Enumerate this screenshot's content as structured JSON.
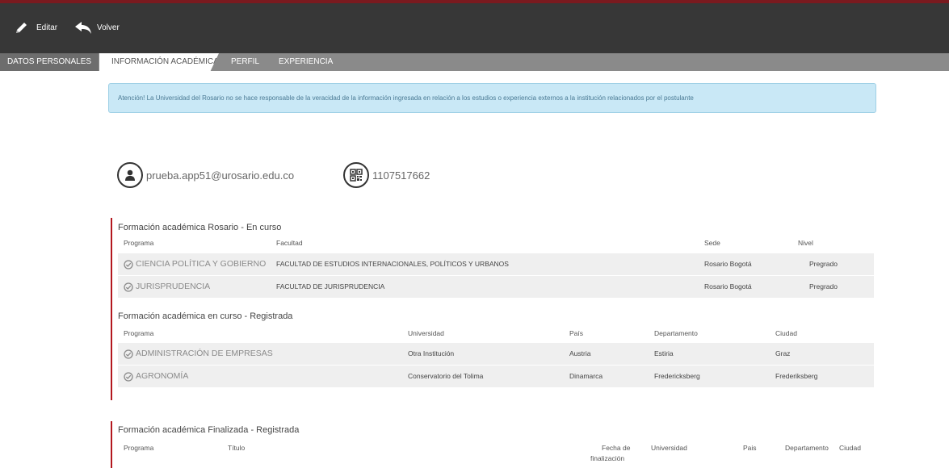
{
  "toolbar": {
    "edit_label": "Editar",
    "back_label": "Volver",
    "edit_icon": "pencil-icon",
    "back_icon": "undo-arrow-icon"
  },
  "tabs": [
    {
      "label": "DATOS PERSONALES",
      "active": false
    },
    {
      "label": "INFORMACIÓN ACADÉMICA",
      "active": true
    },
    {
      "label": "PERFIL",
      "active": false
    },
    {
      "label": "EXPERIENCIA",
      "active": false
    }
  ],
  "alert": {
    "text": "Atención! La Universidad del Rosario no se hace responsable de la veracidad de la información ingresada en relación a los estudios o experiencia externos a la institución relacionados por el postulante"
  },
  "profile": {
    "email": "prueba.app51@urosario.edu.co",
    "id_number": "1107517662",
    "email_icon": "user-icon",
    "id_icon": "qr-code-icon"
  },
  "colors": {
    "topbar": "#373737",
    "accent": "#b3171e",
    "alert_bg": "#c9e8f6",
    "row_bg": "#efefef"
  },
  "rosario_en_curso": {
    "title": "Formación académica Rosario - En curso",
    "headers": {
      "programa": "Programa",
      "facultad": "Facultad",
      "sede": "Sede",
      "nivel": "Nivel"
    },
    "rows": [
      {
        "programa": "CIENCIA POLÍTICA Y GOBIERNO",
        "facultad": "FACULTAD DE ESTUDIOS INTERNACIONALES, POLÍTICOS Y URBANOS",
        "sede": "Rosario Bogotá",
        "nivel": "Pregrado"
      },
      {
        "programa": "JURISPRUDENCIA",
        "facultad": "FACULTAD DE JURISPRUDENCIA",
        "sede": "Rosario Bogotá",
        "nivel": "Pregrado"
      }
    ]
  },
  "en_curso_registrada": {
    "title": "Formación académica en curso - Registrada",
    "headers": {
      "programa": "Programa",
      "universidad": "Universidad",
      "pais": "País",
      "departamento": "Departamento",
      "ciudad": "Ciudad"
    },
    "rows": [
      {
        "programa": "ADMINISTRACIÓN DE EMPRESAS",
        "universidad": "Otra Institución",
        "pais": "Austria",
        "departamento": "Estiria",
        "ciudad": "Graz"
      },
      {
        "programa": "AGRONOMÍA",
        "universidad": "Conservatorio del Tolima",
        "pais": "Dinamarca",
        "departamento": "Fredericksberg",
        "ciudad": "Frederiksberg"
      }
    ]
  },
  "finalizada_registrada": {
    "title": "Formación académica Finalizada - Registrada",
    "headers": {
      "programa": "Programa",
      "titulo": "Título",
      "fecha_1": "Fecha de",
      "fecha_2": "finalización",
      "universidad": "Universidad",
      "pais": "Pais",
      "departamento": "Departamento",
      "ciudad": "Ciudad"
    }
  }
}
